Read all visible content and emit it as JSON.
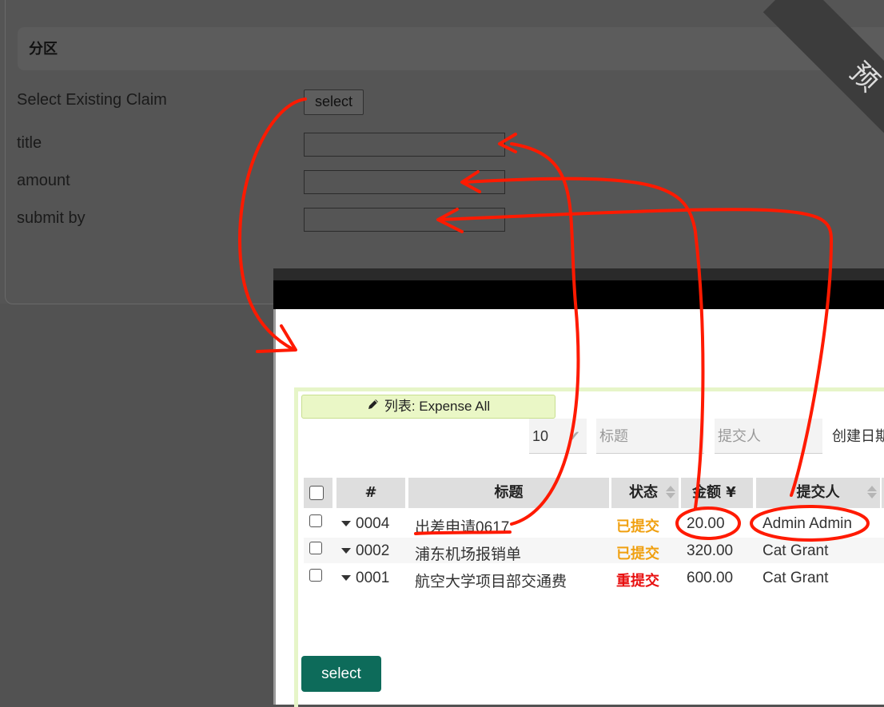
{
  "form": {
    "section_title": "分区",
    "fields": [
      {
        "label": "Select Existing Claim"
      },
      {
        "label": "title",
        "value": ""
      },
      {
        "label": "amount",
        "value": ""
      },
      {
        "label": "submit by",
        "value": ""
      }
    ],
    "select_button_label": "select",
    "ribbon_text": "预"
  },
  "modal": {
    "list_tab_label": "列表: Expense All",
    "list_tab_icon": "pencil-icon",
    "filters": {
      "page_size": "10",
      "title_placeholder": "标题",
      "submitter_placeholder": "提交人",
      "created_date_label": "创建日期"
    },
    "columns": [
      "#",
      "标题",
      "状态",
      "金额 ¥",
      "提交人"
    ],
    "rows": [
      {
        "id": "0004",
        "title": "出差申请0617",
        "status": "已提交",
        "amount": "20.00",
        "submitter": "Admin Admin"
      },
      {
        "id": "0002",
        "title": "浦东机场报销单",
        "status": "已提交",
        "amount": "320.00",
        "submitter": "Cat Grant"
      },
      {
        "id": "0001",
        "title": "航空大学项目部交通费",
        "status": "重提交",
        "amount": "600.00",
        "submitter": "Cat Grant"
      }
    ],
    "select_button_label": "select"
  },
  "colors": {
    "status_submitted": "#f0a010",
    "status_resubmitted": "#e81010",
    "primary_button": "#0d6b5a",
    "annotation": "#ff1a00"
  }
}
